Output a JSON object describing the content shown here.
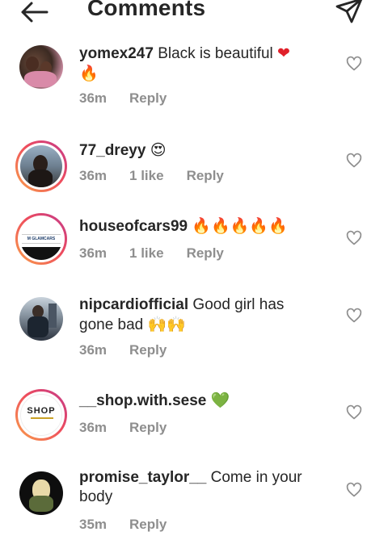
{
  "header": {
    "title": "Comments"
  },
  "comments": [
    {
      "username": "yomex247",
      "text": "Black is beautiful",
      "emoji": "❤",
      "emoji2": "🔥",
      "time": "36m",
      "likes": "",
      "reply": "Reply"
    },
    {
      "username": "77_dreyy",
      "text": "",
      "emoji": "😍",
      "time": "36m",
      "likes": "1 like",
      "reply": "Reply"
    },
    {
      "username": "houseofcars99",
      "text": "",
      "emoji": "🔥🔥🔥🔥🔥",
      "time": "36m",
      "likes": "1 like",
      "reply": "Reply",
      "avatar_text": "M GLAMCARS"
    },
    {
      "username": "nipcardiofficial",
      "text": "Good girl has gone bad",
      "emoji": "🙌🙌",
      "time": "36m",
      "likes": "",
      "reply": "Reply"
    },
    {
      "username": "__shop.with.sese",
      "text": "",
      "emoji": "💚",
      "time": "36m",
      "likes": "",
      "reply": "Reply",
      "avatar_text": "SHOP"
    },
    {
      "username": "promise_taylor__",
      "text": "Come in your body",
      "emoji": "",
      "time": "35m",
      "likes": "",
      "reply": "Reply"
    }
  ],
  "colors": {
    "text": "#262626",
    "meta": "#8e8e8e",
    "story_ring_start": "#f9a14a",
    "story_ring_end": "#c23a8c"
  },
  "icons": {
    "back": "arrow-left-icon",
    "send": "paper-plane-icon",
    "like": "heart-outline-icon"
  }
}
